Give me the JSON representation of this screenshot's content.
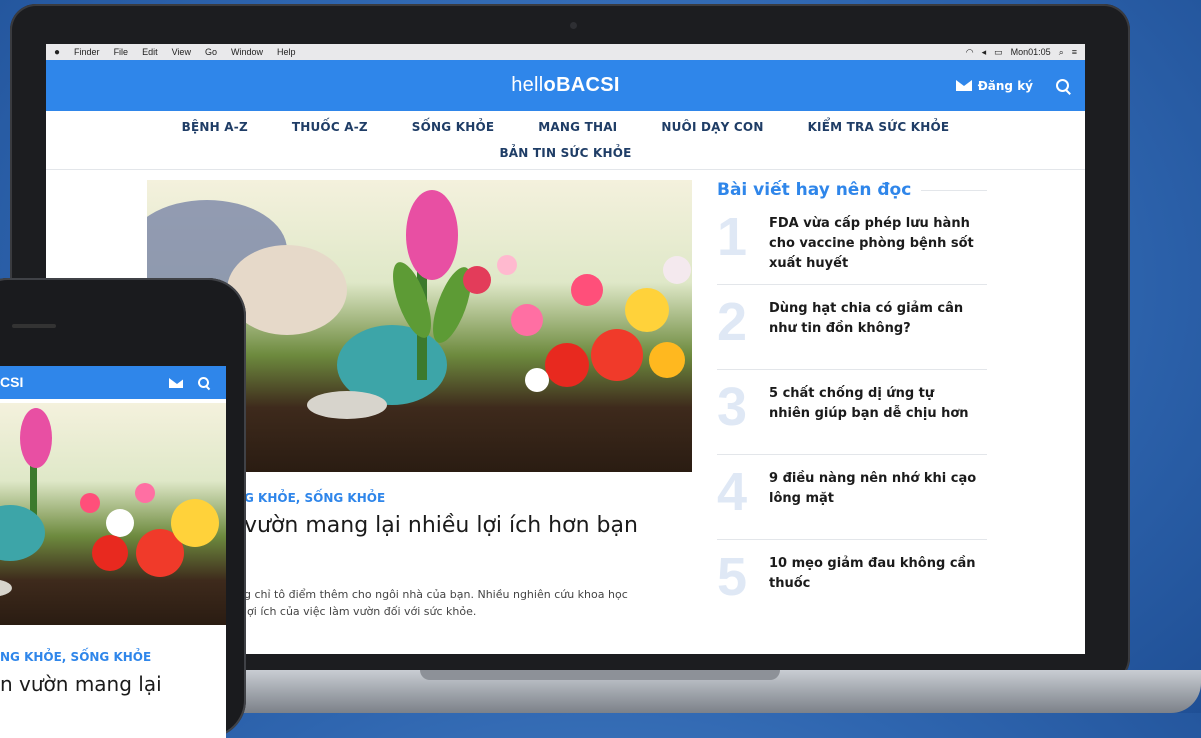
{
  "menubar": {
    "apple": "",
    "items": [
      "Finder",
      "File",
      "Edit",
      "View",
      "Go",
      "Window",
      "Help"
    ],
    "clock": "Mon01:05"
  },
  "header": {
    "logo_prefix": "hell",
    "logo_mark": "o",
    "logo_suffix": "BACSI",
    "register_label": "Đăng ký"
  },
  "nav": {
    "row1": [
      "BỆNH A-Z",
      "THUỐC A-Z",
      "SỐNG KHỎE",
      "MANG THAI",
      "NUÔI DẠY CON",
      "KIỂM TRA SỨC KHỎE"
    ],
    "row2": [
      "BẢN TIN SỨC KHỎE"
    ]
  },
  "article": {
    "category": "G KHỎE, SỐNG KHỎE",
    "title": "vườn mang lại nhiều lợi ích hơn bạn",
    "desc_line1": "g chỉ tô điểm thêm cho ngôi nhà của bạn. Nhiều nghiên cứu khoa học",
    "desc_line2": "lợi ích của việc làm vườn đối với sức khỏe."
  },
  "sidebar": {
    "title": "Bài viết hay nên đọc",
    "items": [
      {
        "num": "1",
        "text": "FDA vừa cấp phép lưu hành cho vaccine phòng bệnh sốt xuất huyết"
      },
      {
        "num": "2",
        "text": "Dùng hạt chia có giảm cân như tin đồn không?"
      },
      {
        "num": "3",
        "text": "5 chất chống dị ứng tự nhiên giúp bạn dễ chịu hơn"
      },
      {
        "num": "4",
        "text": "9 điều nàng nên nhớ khi cạo lông mặt"
      },
      {
        "num": "5",
        "text": "10 mẹo giảm đau không cần thuốc"
      }
    ]
  },
  "phone": {
    "logo": "CSI",
    "category": "NG KHỎE, SỐNG KHỎE",
    "title": "n vườn mang lại"
  },
  "colors": {
    "brand_blue": "#2f86ea",
    "nav_text": "#1f3d66"
  }
}
